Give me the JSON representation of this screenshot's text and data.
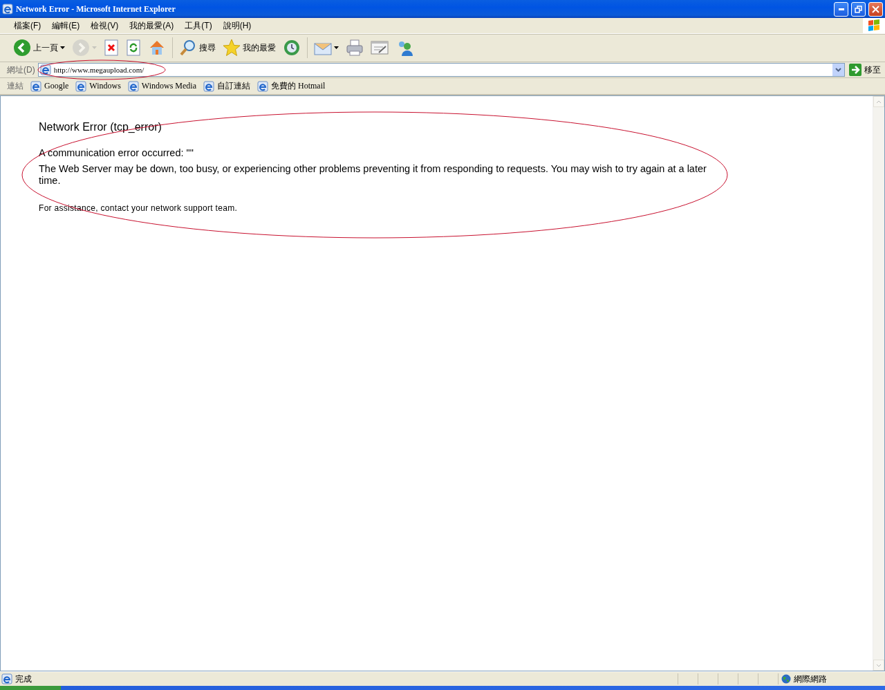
{
  "window": {
    "title": "Network Error - Microsoft Internet Explorer"
  },
  "menu": [
    {
      "label": "檔案(F)"
    },
    {
      "label": "編輯(E)"
    },
    {
      "label": "檢視(V)"
    },
    {
      "label": "我的最愛(A)"
    },
    {
      "label": "工具(T)"
    },
    {
      "label": "說明(H)"
    }
  ],
  "toolbar": [
    {
      "label": "上一頁",
      "disabled": false,
      "dropdown": true
    },
    {
      "disabled": true,
      "dropdown": true
    },
    {
      "disabled": false,
      "dropdown": false
    },
    {
      "disabled": false,
      "dropdown": false
    },
    {
      "disabled": false,
      "dropdown": false
    },
    {
      "label": "搜尋",
      "disabled": false,
      "dropdown": false
    },
    {
      "label": "我的最愛",
      "disabled": false,
      "dropdown": false
    },
    {
      "disabled": false,
      "dropdown": false
    },
    {
      "disabled": false,
      "dropdown": true
    },
    {
      "disabled": false,
      "dropdown": false
    },
    {
      "disabled": false,
      "dropdown": false
    },
    {
      "disabled": false,
      "dropdown": false
    }
  ],
  "address_bar": {
    "label": "網址(D)",
    "value": "http://www.megaupload.com/",
    "go_label": "移至"
  },
  "links_bar": {
    "label": "連結",
    "links": [
      "Google",
      "Windows",
      "Windows Media",
      "自訂連結",
      "免費的 Hotmail"
    ]
  },
  "page": {
    "heading": "Network Error (tcp_error)",
    "message": "A communication error occurred: \"\"",
    "details": "The Web Server may be down, too busy, or experiencing other problems preventing it from responding to requests. You may wish to try again at a later time.",
    "assistance": "For assistance, contact your network support team."
  },
  "status_bar": {
    "text": "完成",
    "zone": "網際網路"
  }
}
